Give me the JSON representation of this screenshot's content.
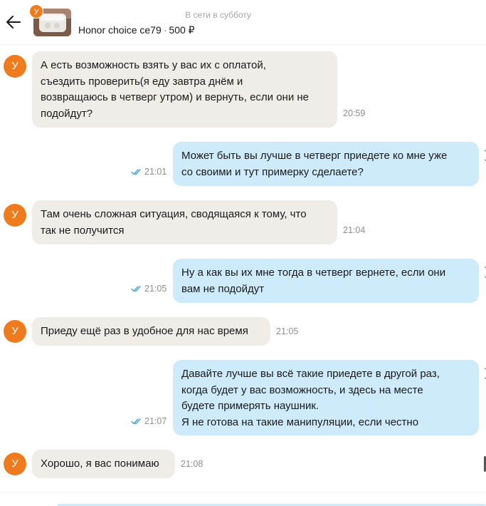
{
  "header": {
    "status": "В сети в субботу",
    "seller_initial": "У",
    "product_name": "Honor choice ce79",
    "separator": "·",
    "price": "500 ₽"
  },
  "messages": [
    {
      "from": "seller",
      "avatar": "У",
      "text": "А есть возможность взять у вас их с оплатой,\nсъездить проверить(я еду завтра днём и\nвозвращаюсь в четверг утром) и вернуть, если они не\nподойдут?",
      "time": "20:59"
    },
    {
      "from": "me",
      "text": "Может быть  вы лучше в четверг приедете ко мне уже\nсо своими и тут примерку сделаете?",
      "time": "21:01"
    },
    {
      "from": "seller",
      "avatar": "У",
      "text": "Там очень сложная ситуация, сводящаяся к тому, что\nтак не получится",
      "time": "21:04"
    },
    {
      "from": "me",
      "text": "Ну а как вы их мне тогда в четверг вернете, если они\nвам не подойдут",
      "time": "21:05"
    },
    {
      "from": "seller",
      "avatar": "У",
      "text": "Приеду ещё раз в удобное для нас время",
      "time": "21:05"
    },
    {
      "from": "me",
      "text": "Давайте лучше вы всё такие приедете в другой раз,\nкогда будет у вас возможность, и здесь на месте\nбудете примерять наушник.\nЯ не готова на такие манипуляции, если честно",
      "time": "21:07"
    },
    {
      "from": "seller",
      "avatar": "У",
      "text": "Хорошо, я вас понимаю",
      "time": "21:08"
    }
  ],
  "colors": {
    "avatar": "#f07b1d",
    "incoming_bubble": "#f0ede8",
    "outgoing_bubble": "#cdebfb",
    "read_ticks": "#3fa0d8"
  },
  "icons": {
    "back": "arrow-left-icon",
    "read": "double-check-icon"
  }
}
